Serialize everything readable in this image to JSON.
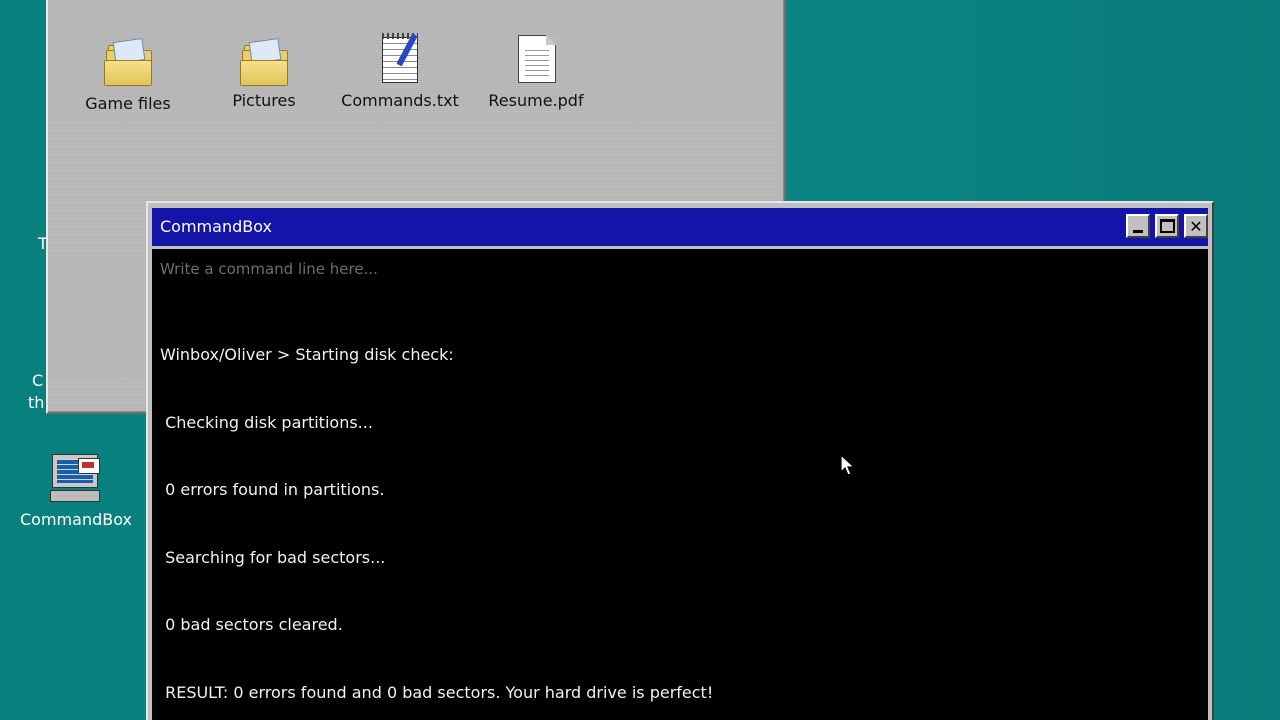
{
  "explorer": {
    "files": [
      {
        "label": "Game files",
        "icon": "folder-icon"
      },
      {
        "label": "Pictures",
        "icon": "folder-icon"
      },
      {
        "label": "Commands.txt",
        "icon": "notepad-icon"
      },
      {
        "label": "Resume.pdf",
        "icon": "document-icon"
      }
    ]
  },
  "desktop": {
    "icons": [
      {
        "label": "CommandBox",
        "icon": "computer-icon"
      }
    ],
    "partial_text": [
      "T",
      "C",
      "th"
    ]
  },
  "command_window": {
    "title": "CommandBox",
    "input_placeholder": "Write a command line here...",
    "output_lines": [
      "Winbox/Oliver > Starting disk check:",
      " Checking disk partitions...",
      " 0 errors found in partitions.",
      " Searching for bad sectors...",
      " 0 bad sectors cleared.",
      " RESULT: 0 errors found and 0 bad sectors. Your hard drive is perfect!"
    ],
    "buttons": {
      "minimize": "minimize-icon",
      "maximize": "maximize-icon",
      "close": "close-icon"
    }
  },
  "colors": {
    "desktop_background": "#0b8786",
    "titlebar": "#1414a8",
    "console_background": "#000000",
    "console_text": "#f2f2f2"
  }
}
